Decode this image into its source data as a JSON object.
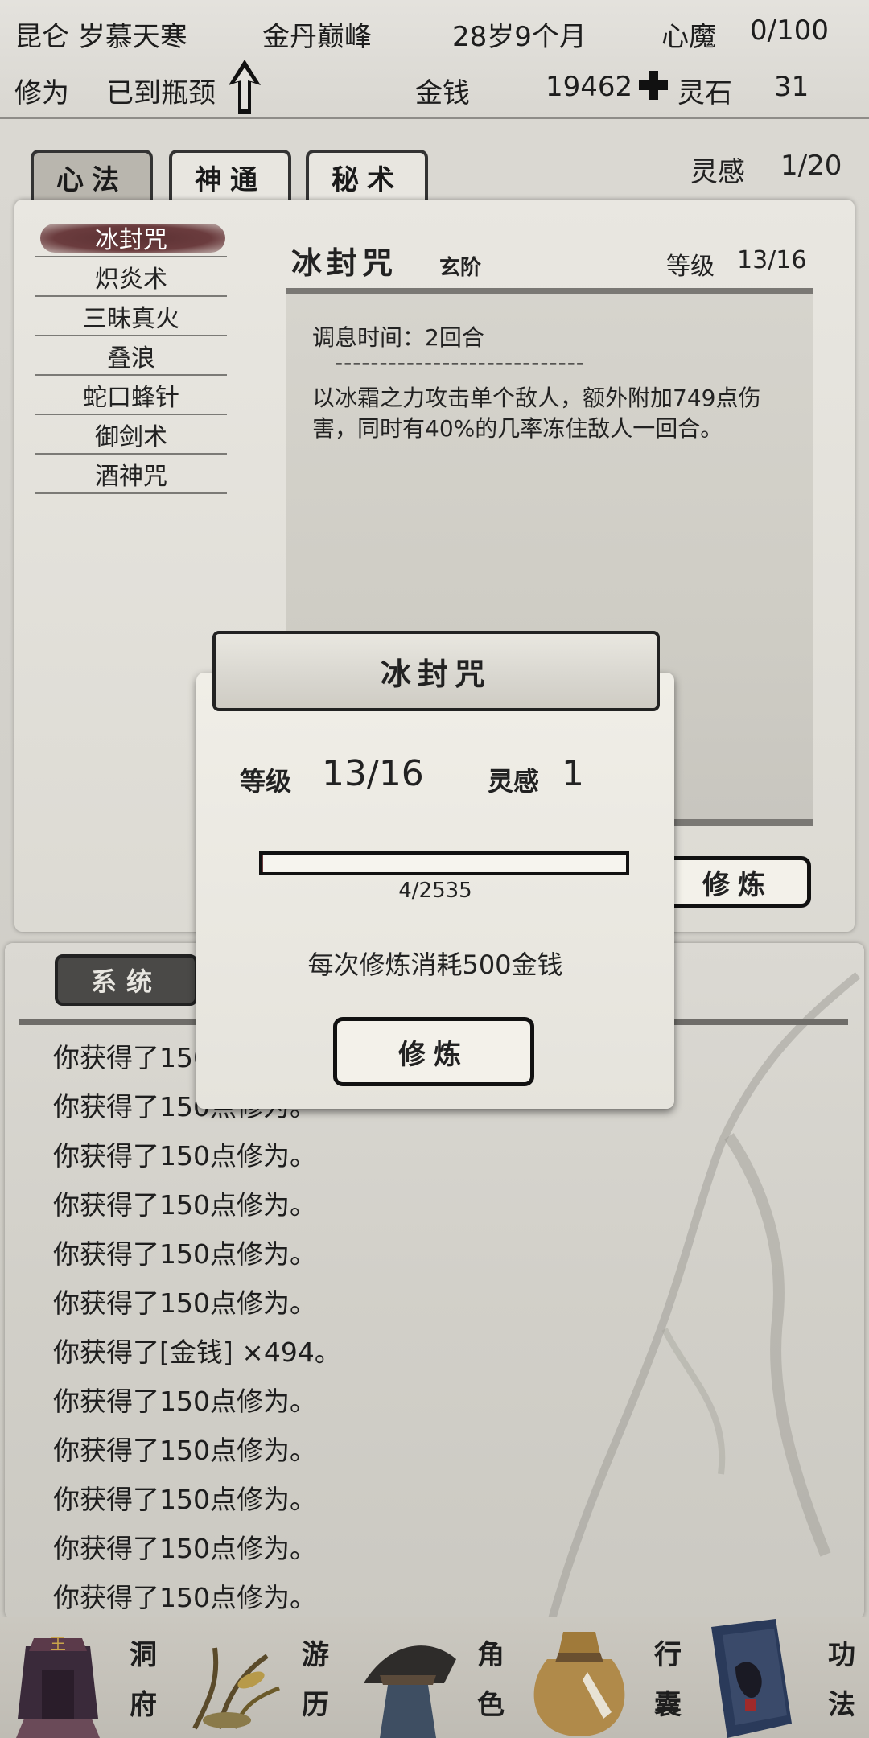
{
  "header": {
    "location": "昆仑 岁慕天寒",
    "realm": "金丹巅峰",
    "age": "28岁9个月",
    "demon_label": "心魔",
    "demon_value": "0/100",
    "cultivation_label": "修为",
    "cultivation_value": "已到瓶颈",
    "money_label": "金钱",
    "money_value": "19462",
    "spirit_stone_label": "灵石",
    "spirit_stone_value": "31"
  },
  "tabs": [
    {
      "label": "心法"
    },
    {
      "label": "神通"
    },
    {
      "label": "秘术"
    }
  ],
  "inspiration": {
    "label": "灵感",
    "value": "1/20"
  },
  "skills": [
    "冰封咒",
    "炽炎术",
    "三昧真火",
    "叠浪",
    "蛇口蜂针",
    "御剑术",
    "酒神咒"
  ],
  "detail": {
    "name": "冰封咒",
    "tier": "玄阶",
    "level_label": "等级",
    "level_value": "13/16",
    "cooldown": "调息时间：2回合",
    "divider": "----------------------------",
    "description": "以冰霜之力攻击单个敌人，额外附加749点伤害，同时有40%的几率冻住敌人一回合。",
    "practice_label": "修炼"
  },
  "log": {
    "tab_label": "系统",
    "lines": [
      "你获得了150点修为。",
      "你获得了150点修为。",
      "你获得了150点修为。",
      "你获得了150点修为。",
      "你获得了150点修为。",
      "你获得了150点修为。",
      "你获得了[金钱] ×494。",
      "你获得了150点修为。",
      "你获得了150点修为。",
      "你获得了150点修为。",
      "你获得了150点修为。",
      "你获得了150点修为。"
    ]
  },
  "modal": {
    "title": "冰封咒",
    "level_label": "等级",
    "level_value": "13/16",
    "inspiration_label": "灵感",
    "inspiration_value": "1",
    "progress_text": "4/2535",
    "progress_fraction": 0.0016,
    "cost_text": "每次修炼消耗500金钱",
    "button_label": "修炼"
  },
  "nav": [
    {
      "label_top": "洞",
      "label_bottom": "府",
      "icon": "cave-icon"
    },
    {
      "label_top": "游",
      "label_bottom": "历",
      "icon": "travel-icon"
    },
    {
      "label_top": "角",
      "label_bottom": "色",
      "icon": "character-icon"
    },
    {
      "label_top": "行",
      "label_bottom": "囊",
      "icon": "bag-icon"
    },
    {
      "label_top": "功",
      "label_bottom": "法",
      "icon": "technique-icon"
    }
  ],
  "colors": {
    "accent_dark": "#222222",
    "selected_skill": "#5a3032",
    "panel_bg": "#e6e4de"
  }
}
